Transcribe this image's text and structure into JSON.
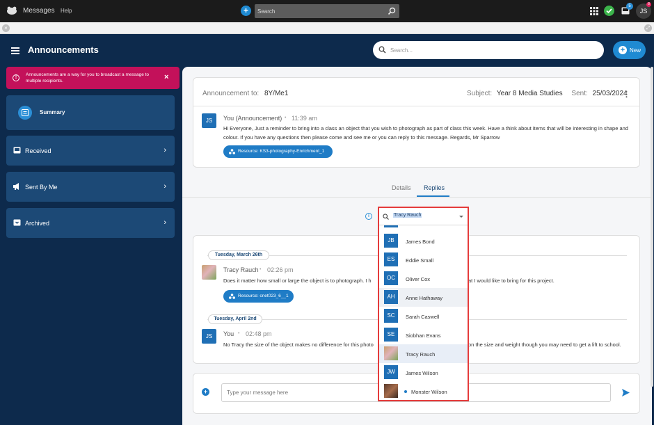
{
  "topbar": {
    "app_name": "Messages",
    "help_label": "Help",
    "search_placeholder": "Search",
    "inbox_badge": "5",
    "avatar_initials": "JS",
    "avatar_badge": "8"
  },
  "header": {
    "title": "Announcements",
    "search_placeholder": "Search...",
    "new_label": "New"
  },
  "sidebar": {
    "alert_text": "Announcements are a way for you to broadcast a message to multiple recipients.",
    "items": [
      {
        "label": "Summary",
        "icon": "list-icon"
      },
      {
        "label": "Received",
        "icon": "inbox-icon"
      },
      {
        "label": "Sent By Me",
        "icon": "megaphone-icon"
      },
      {
        "label": "Archived",
        "icon": "archive-icon"
      }
    ]
  },
  "announcement": {
    "to_label": "Announcement to:",
    "to_value": "8Y/Me1",
    "subject_label": "Subject:",
    "subject_value": "Year 8 Media Studies",
    "sent_label": "Sent:",
    "sent_value": "25/03/2024",
    "author_initials": "JS",
    "author": "You (Announcement)",
    "time": "11:39 am",
    "body": "Hi Everyone, Just a reminder to bring into a class an object that you wish to photograph as part of class this week. Have a think about items that will be interesting in shape and colour. If you have any questions then please come and see me or you can reply to this message. Regards, Mr Sparrow",
    "resource": "Resource: KS3-photography-Enrichment_1"
  },
  "tabs": [
    "Details",
    "Replies"
  ],
  "replies": [
    {
      "date": "Tuesday, March 26th",
      "author": "Tracy Rauch",
      "time": "02:26 pm",
      "body": "Does it matter how small or large the object is to photograph. I h",
      "body_tail": "at I would like to bring for this project.",
      "resource": "Resource: cnet023_6__1"
    },
    {
      "date": "Tuesday, April 2nd",
      "author_initials": "JS",
      "author": "You",
      "time": "02:48 pm",
      "body": "No Tracy the size of the object makes no difference for this photo",
      "body_tail": "on the size and weight though you may need to get a lift to school."
    }
  ],
  "composer": {
    "placeholder": "Type your message here"
  },
  "dropdown": {
    "selected": "Tracy Rauch",
    "items": [
      {
        "initials": "JB",
        "name": "James Bond"
      },
      {
        "initials": "ES",
        "name": "Eddie Small"
      },
      {
        "initials": "OC",
        "name": "Oliver Cox"
      },
      {
        "initials": "AH",
        "name": "Anne Hathaway"
      },
      {
        "initials": "SC",
        "name": "Sarah Caswell"
      },
      {
        "initials": "SE",
        "name": "Siobhan Evans"
      },
      {
        "initials": "",
        "name": "Tracy Rauch"
      },
      {
        "initials": "JW",
        "name": "James Wilson"
      },
      {
        "initials": "",
        "name": "Monster Wilson"
      }
    ]
  },
  "colors": {
    "navy": "#0d2a4c",
    "nav_item": "#1c4976",
    "accent_blue": "#1f8ad2",
    "alert_pink": "#c3115a",
    "highlight_border": "#e53b3b"
  }
}
